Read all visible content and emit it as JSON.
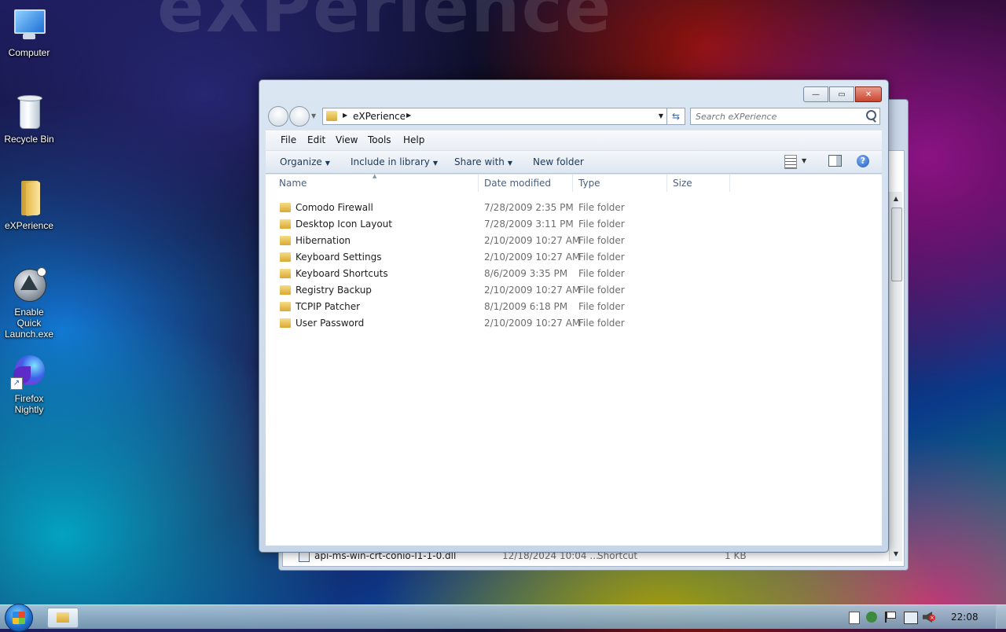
{
  "background_text": "eXPerience",
  "desktop_icons": [
    {
      "label": "Computer",
      "icon": "computer-icon"
    },
    {
      "label": "Recycle Bin",
      "icon": "recycle-bin-icon"
    },
    {
      "label": "eXPerience",
      "icon": "folder-icon"
    },
    {
      "label": "Enable Quick Launch.exe",
      "icon": "quick-launch-icon"
    },
    {
      "label": "Firefox Nightly",
      "icon": "firefox-nightly-icon"
    }
  ],
  "window": {
    "title": "",
    "address": {
      "crumb": "eXPerience"
    },
    "search_placeholder": "Search eXPerience",
    "menu": [
      "File",
      "Edit",
      "View",
      "Tools",
      "Help"
    ],
    "toolbar": {
      "organize": "Organize",
      "include_in_library": "Include in library",
      "share_with": "Share with",
      "new_folder": "New folder"
    },
    "columns": {
      "name": "Name",
      "date_modified": "Date modified",
      "type": "Type",
      "size": "Size"
    },
    "files": [
      {
        "name": "Comodo Firewall",
        "date": "7/28/2009 2:35 PM",
        "type": "File folder"
      },
      {
        "name": "Desktop Icon Layout",
        "date": "7/28/2009 3:11 PM",
        "type": "File folder"
      },
      {
        "name": "Hibernation",
        "date": "2/10/2009 10:27 AM",
        "type": "File folder"
      },
      {
        "name": "Keyboard Settings",
        "date": "2/10/2009 10:27 AM",
        "type": "File folder"
      },
      {
        "name": "Keyboard Shortcuts",
        "date": "8/6/2009 3:35 PM",
        "type": "File folder"
      },
      {
        "name": "Registry Backup",
        "date": "2/10/2009 10:27 AM",
        "type": "File folder"
      },
      {
        "name": "TCPIP Patcher",
        "date": "8/1/2009 6:18 PM",
        "type": "File folder"
      },
      {
        "name": "User Password",
        "date": "2/10/2009 10:27 AM",
        "type": "File folder"
      }
    ]
  },
  "back_window": {
    "row": {
      "name": "api-ms-win-crt-conio-l1-1-0.dll",
      "date": "12/18/2024 10:04 ...",
      "type": "Shortcut",
      "size": "1 KB"
    }
  },
  "taskbar": {
    "clock": "22:08"
  }
}
